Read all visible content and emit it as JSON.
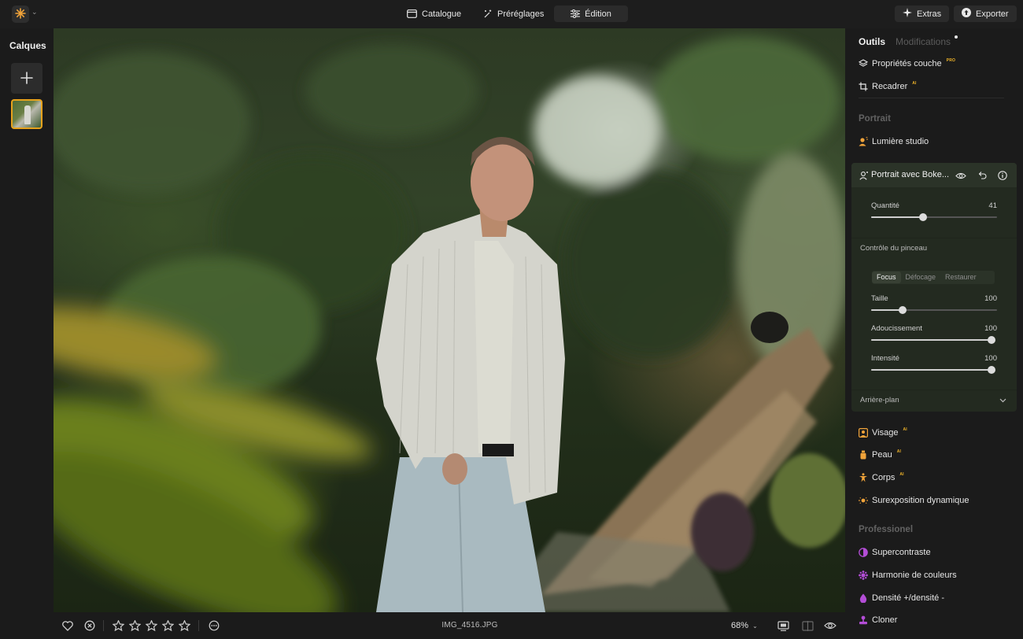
{
  "topbar": {
    "nav": [
      {
        "label": "Catalogue",
        "icon": "folder-icon"
      },
      {
        "label": "Préréglages",
        "icon": "magic-wand-icon"
      },
      {
        "label": "Édition",
        "icon": "sliders-icon",
        "active": true
      }
    ],
    "extras_label": "Extras",
    "export_label": "Exporter"
  },
  "layers": {
    "title": "Calques"
  },
  "bottombar": {
    "filename": "IMG_4516.JPG",
    "zoom": "68%",
    "rating_stars": 0,
    "rating_max": 5
  },
  "tools": {
    "tabs": {
      "outils": "Outils",
      "modifications": "Modifications"
    },
    "items_top": [
      {
        "label": "Propriétés couche",
        "badge": "PRO",
        "icon": "layers-icon"
      },
      {
        "label": "Recadrer",
        "badge": "AI",
        "icon": "crop-icon"
      }
    ],
    "portrait_title": "Portrait",
    "lumiere": {
      "label": "Lumière studio",
      "icon": "studio-light-icon"
    },
    "bokeh": {
      "title": "Portrait avec Boke...",
      "quantity_label": "Quantité",
      "quantity_value": "41",
      "quantity": 41,
      "brush_title": "Contrôle du pinceau",
      "modes": [
        "Focus",
        "Défocage",
        "Restaurer"
      ],
      "active_mode": "Focus",
      "taille_label": "Taille",
      "taille_value": "100",
      "taille_position": 0.25,
      "adoucissement_label": "Adoucissement",
      "adoucissement_value": "100",
      "adoucissement": 100,
      "intensite_label": "Intensité",
      "intensite_value": "100",
      "intensite": 100,
      "background_label": "Arrière-plan"
    },
    "items_portrait": [
      {
        "label": "Visage",
        "badge": "AI",
        "icon": "face-icon",
        "color": "#f0a33a"
      },
      {
        "label": "Peau",
        "badge": "AI",
        "icon": "skin-icon",
        "color": "#f0a33a"
      },
      {
        "label": "Corps",
        "badge": "AI",
        "icon": "body-icon",
        "color": "#f0a33a"
      },
      {
        "label": "Surexposition dynamique",
        "badge": "",
        "icon": "dynamic-light-icon",
        "color": "#f0a33a"
      }
    ],
    "professional_title": "Professionel",
    "items_pro": [
      {
        "label": "Supercontraste",
        "icon": "contrast-icon",
        "color": "#b34dd6"
      },
      {
        "label": "Harmonie de couleurs",
        "icon": "color-harmony-icon",
        "color": "#b34dd6"
      },
      {
        "label": "Densité +/densité -",
        "icon": "density-icon",
        "color": "#b34dd6"
      },
      {
        "label": "Cloner",
        "icon": "clone-icon",
        "color": "#b34dd6"
      }
    ]
  },
  "colors": {
    "accent_orange": "#f0a33a",
    "accent_purple": "#b34dd6",
    "selection_border": "#e7a21c",
    "panel_bg": "#1b1b1b"
  }
}
